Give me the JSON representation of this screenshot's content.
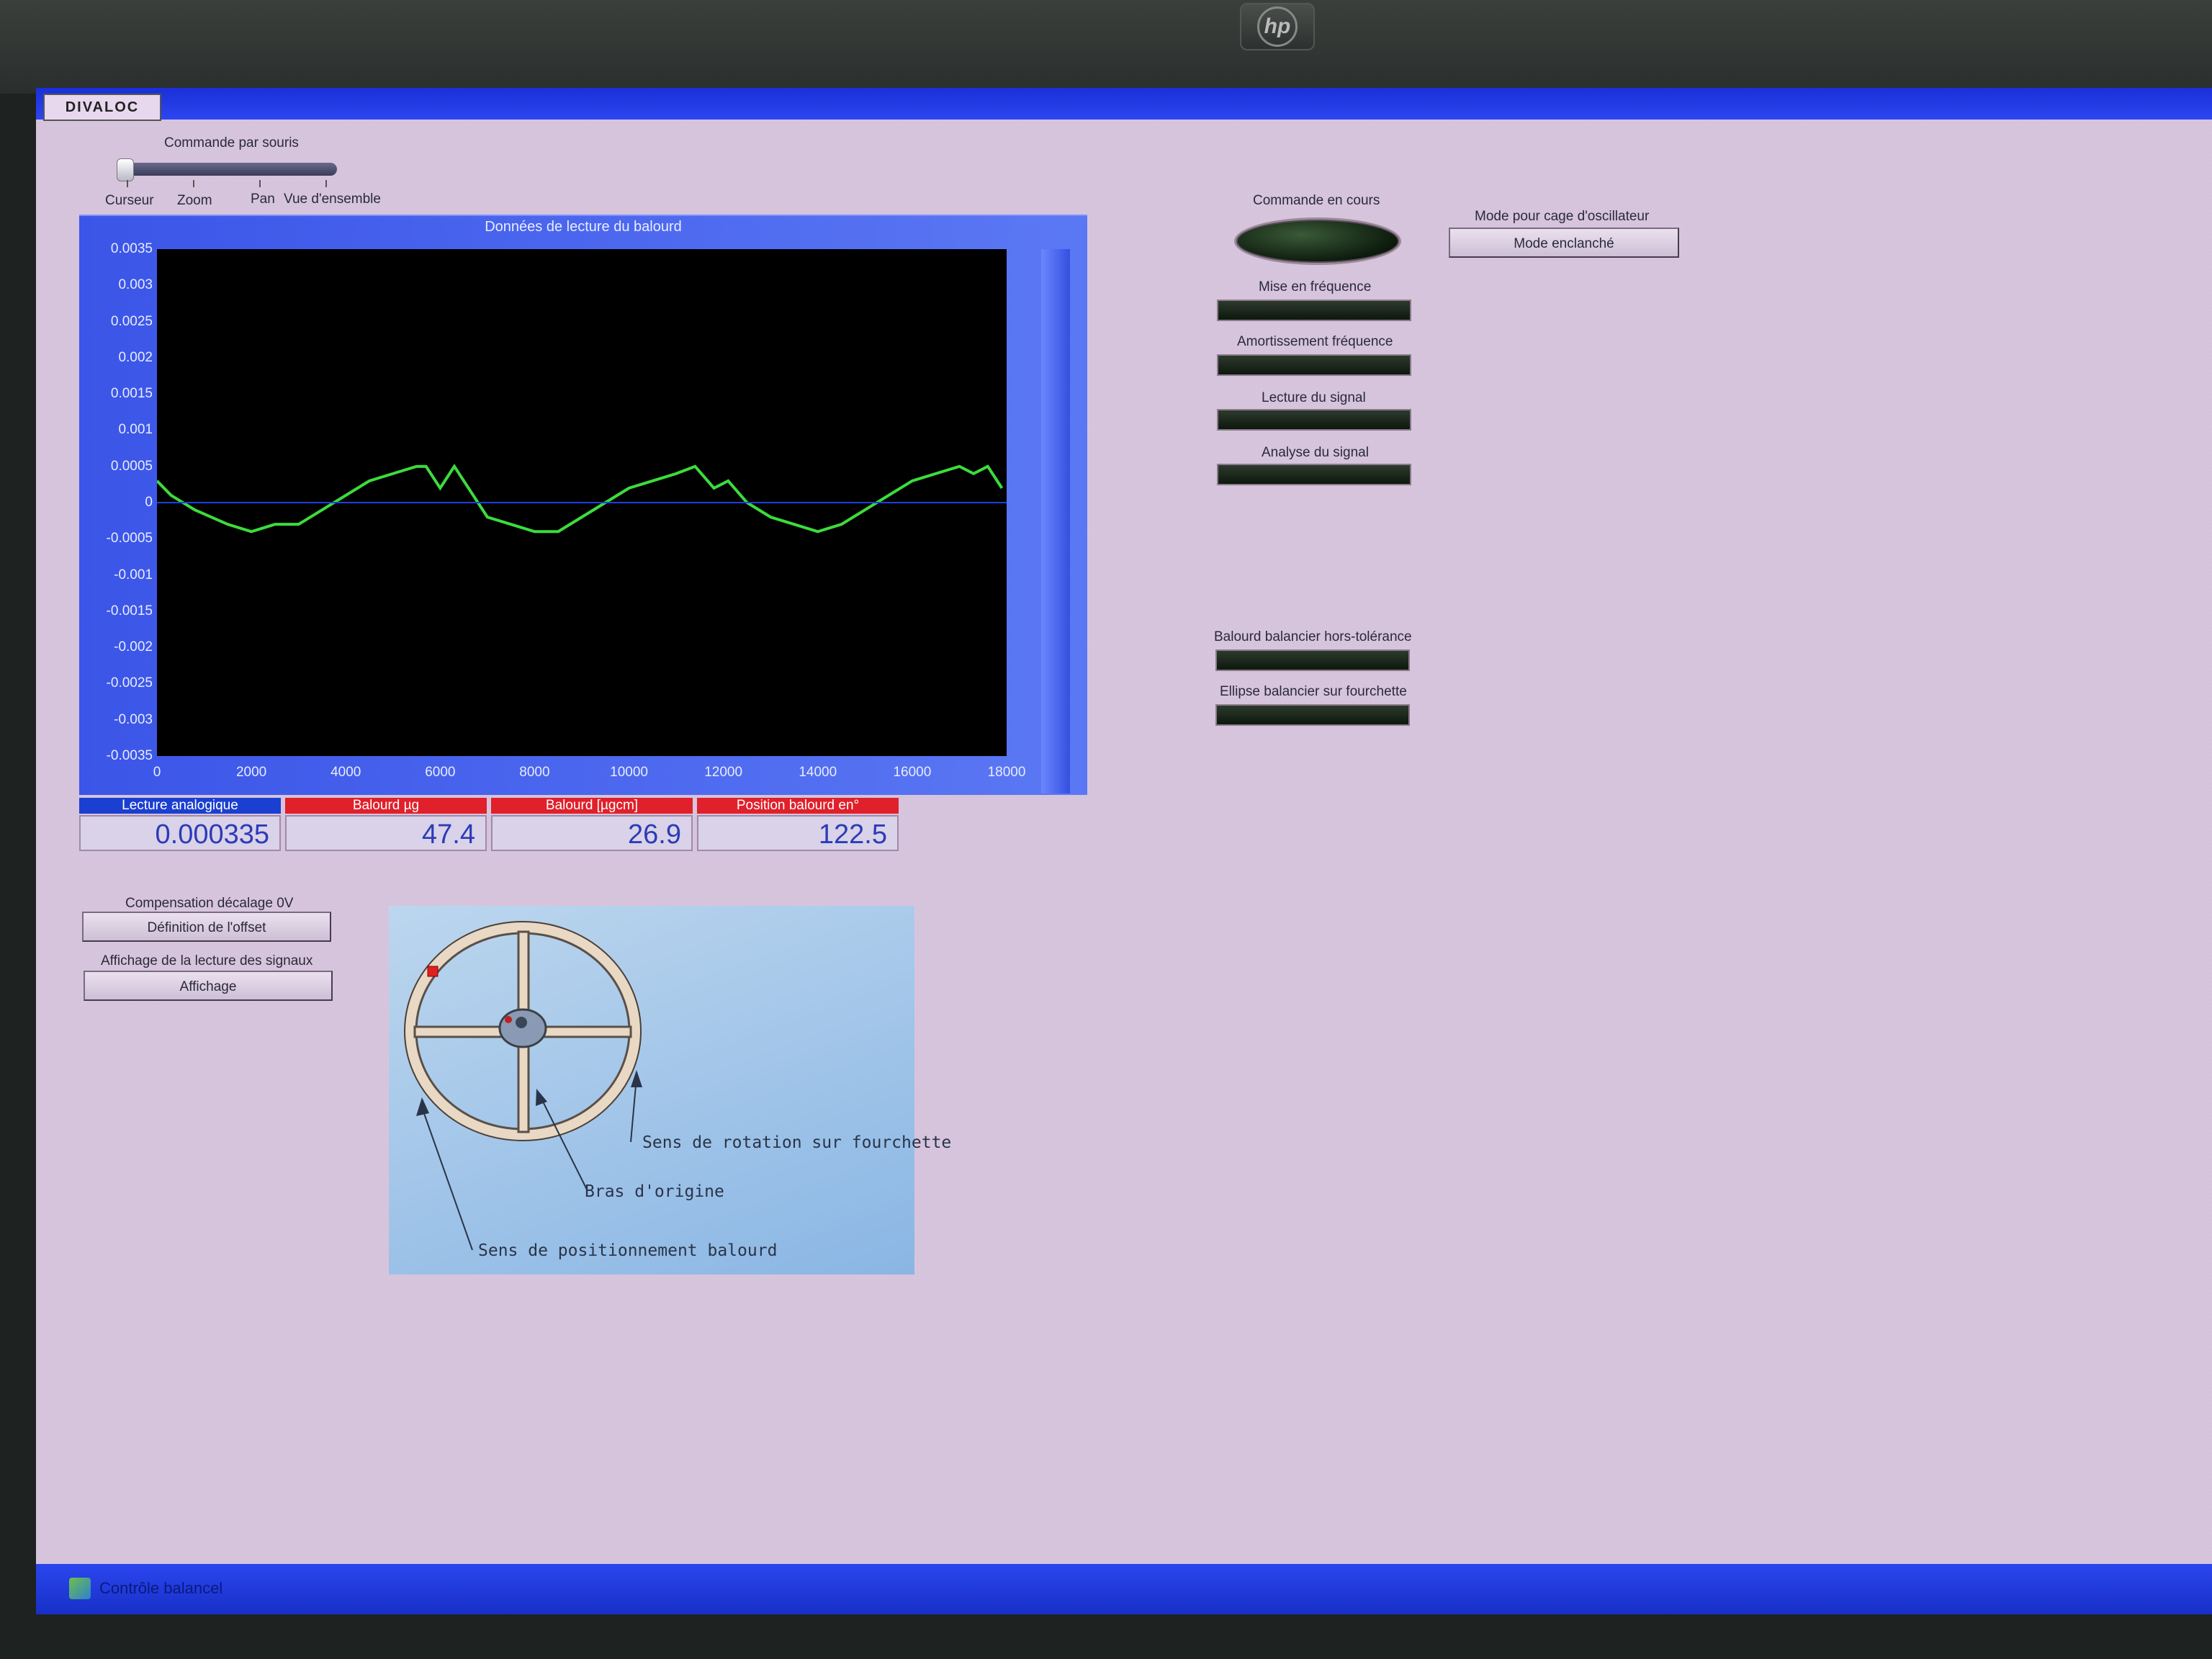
{
  "monitor": {
    "brand": "hp"
  },
  "window": {
    "logo_text": "DIVALOC",
    "taskbar_label": "Contrôle balancel"
  },
  "mouse_control": {
    "label": "Commande par souris",
    "options": [
      "Curseur",
      "Zoom",
      "Pan",
      "Vue d'ensemble"
    ]
  },
  "graph": {
    "title": "Données de lecture du balourd"
  },
  "chart_data": {
    "type": "line",
    "title": "Données de lecture du balourd",
    "xlabel": "",
    "ylabel": "",
    "xlim": [
      0,
      18000
    ],
    "ylim": [
      -0.0035,
      0.0035
    ],
    "x_ticks": [
      "0",
      "2000",
      "4000",
      "6000",
      "8000",
      "10000",
      "12000",
      "14000",
      "16000",
      "18000"
    ],
    "y_ticks": [
      "0.0035",
      "0.003",
      "0.0025",
      "0.002",
      "0.0015",
      "0.001",
      "0.0005",
      "0",
      "-0.0005",
      "-0.001",
      "-0.0015",
      "-0.002",
      "-0.0025",
      "-0.003",
      "-0.0035"
    ],
    "grid": false,
    "series": [
      {
        "color": "#3cdc3c",
        "x": [
          0,
          300,
          800,
          1500,
          2000,
          2500,
          3000,
          3500,
          4000,
          4500,
          5000,
          5500,
          5700,
          6000,
          6300,
          6700,
          7000,
          7500,
          8000,
          8500,
          9000,
          9500,
          10000,
          10500,
          11000,
          11400,
          11800,
          12100,
          12500,
          13000,
          13500,
          14000,
          14500,
          15000,
          15500,
          16000,
          16500,
          17000,
          17300,
          17600,
          17900
        ],
        "values": [
          0.0003,
          0.0001,
          -0.0001,
          -0.0003,
          -0.0004,
          -0.0003,
          -0.0003,
          -0.0001,
          0.0001,
          0.0003,
          0.0004,
          0.0005,
          0.0005,
          0.0002,
          0.0005,
          0.0001,
          -0.0002,
          -0.0003,
          -0.0004,
          -0.0004,
          -0.0002,
          0.0,
          0.0002,
          0.0003,
          0.0004,
          0.0005,
          0.0002,
          0.0003,
          0.0,
          -0.0002,
          -0.0003,
          -0.0004,
          -0.0003,
          -0.0001,
          0.0001,
          0.0003,
          0.0004,
          0.0005,
          0.0004,
          0.0005,
          0.0002
        ]
      },
      {
        "color": "#2040e0",
        "x": [
          0,
          18000
        ],
        "values": [
          0,
          0
        ]
      }
    ]
  },
  "indicators": [
    {
      "label": "Lecture analogique",
      "value": "0.000335",
      "color": "#1b3fd0"
    },
    {
      "label": "Balourd µg",
      "value": "47.4",
      "color": "#e0202a"
    },
    {
      "label": "Balourd [µgcm]",
      "value": "26.9",
      "color": "#e0202a"
    },
    {
      "label": "Position balourd en°",
      "value": "122.5",
      "color": "#e0202a"
    }
  ],
  "offset": {
    "label": "Compensation décalage 0V",
    "button": "Définition de l'offset"
  },
  "display": {
    "label": "Affichage de la lecture des signaux",
    "button": "Affichage"
  },
  "current_command": {
    "label": "Commande en cours"
  },
  "status_leds": [
    "Mise en fréquence",
    "Amortissement fréquence",
    "Lecture du signal",
    "Analyse du signal"
  ],
  "alarm_leds": [
    "Balourd balancier hors-tolérance",
    "Ellipse balancier sur fourchette"
  ],
  "oscillator": {
    "label": "Mode pour cage d'oscillateur",
    "button": "Mode enclanché"
  },
  "diagram": {
    "ann_rotation": "Sens de rotation sur fourchette",
    "ann_origin": "Bras d'origine",
    "ann_position": "Sens de positionnement balourd"
  }
}
